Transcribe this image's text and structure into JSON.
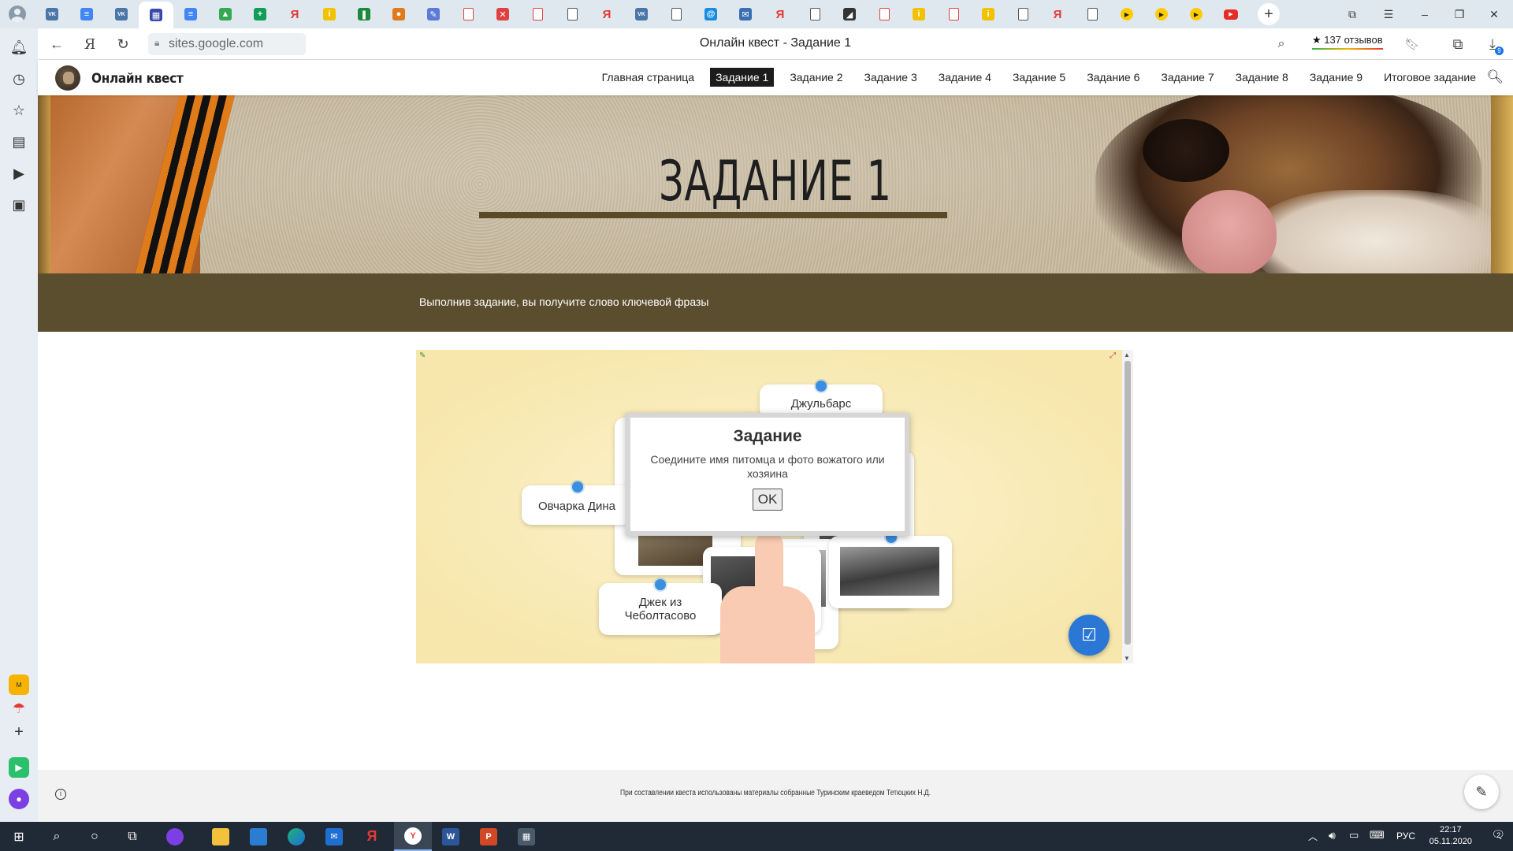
{
  "browser": {
    "tabs": [
      {
        "icon": "vk-icon",
        "glyph": "VK",
        "color": "#4a76a8",
        "kind": "box"
      },
      {
        "icon": "docs-icon",
        "glyph": "≡",
        "color": "#4285f4",
        "kind": "box"
      },
      {
        "icon": "vk-icon",
        "glyph": "VK",
        "color": "#4a76a8",
        "kind": "box"
      },
      {
        "icon": "google-sites-icon",
        "glyph": "▦",
        "color": "#3949ab",
        "kind": "box",
        "active": true
      },
      {
        "icon": "docs-icon",
        "glyph": "≡",
        "color": "#4285f4",
        "kind": "box"
      },
      {
        "icon": "drive-icon",
        "glyph": "▲",
        "color": "#34a853",
        "kind": "box"
      },
      {
        "icon": "sheets-icon",
        "glyph": "+",
        "color": "#0f9d58",
        "kind": "box"
      },
      {
        "icon": "yandex-icon",
        "glyph": "Я",
        "color": "#e53935",
        "kind": "ya"
      },
      {
        "icon": "yellow-tab-icon",
        "glyph": "i",
        "color": "#f2c200",
        "kind": "box"
      },
      {
        "icon": "green-tab-icon",
        "glyph": "❚",
        "color": "#1b8a3a",
        "kind": "box"
      },
      {
        "icon": "colorful-tab-icon",
        "glyph": "●",
        "color": "#e07a1a",
        "kind": "box"
      },
      {
        "icon": "edit-tab-icon",
        "glyph": "✎",
        "color": "#5b7bd6",
        "kind": "box"
      },
      {
        "icon": "pdf-icon",
        "glyph": "",
        "color": "#e04040",
        "kind": "pdf"
      },
      {
        "icon": "red-circle-icon",
        "glyph": "✕",
        "color": "#e04040",
        "kind": "box"
      },
      {
        "icon": "pdf-icon",
        "glyph": "",
        "color": "#e04040",
        "kind": "pdf"
      },
      {
        "icon": "document-icon",
        "glyph": "",
        "color": "#555",
        "kind": "doc"
      },
      {
        "icon": "yandex-icon",
        "glyph": "Я",
        "color": "#e53935",
        "kind": "ya"
      },
      {
        "icon": "vk-icon",
        "glyph": "VK",
        "color": "#4a76a8",
        "kind": "box"
      },
      {
        "icon": "document-icon",
        "glyph": "",
        "color": "#555",
        "kind": "doc"
      },
      {
        "icon": "mail-ru-icon",
        "glyph": "@",
        "color": "#168de2",
        "kind": "box"
      },
      {
        "icon": "mail-icon",
        "glyph": "✉",
        "color": "#3a6fb0",
        "kind": "box"
      },
      {
        "icon": "yandex-icon",
        "glyph": "Я",
        "color": "#e53935",
        "kind": "ya"
      },
      {
        "icon": "document-icon",
        "glyph": "",
        "color": "#555",
        "kind": "doc"
      },
      {
        "icon": "dark-tab-icon",
        "glyph": "◢",
        "color": "#333",
        "kind": "box"
      },
      {
        "icon": "pdf-icon",
        "glyph": "",
        "color": "#e04040",
        "kind": "pdf"
      },
      {
        "icon": "yellow-tab-icon",
        "glyph": "i",
        "color": "#f2c200",
        "kind": "box"
      },
      {
        "icon": "pdf-icon",
        "glyph": "",
        "color": "#e04040",
        "kind": "pdf"
      },
      {
        "icon": "yellow-tab-icon",
        "glyph": "i",
        "color": "#f2c200",
        "kind": "box"
      },
      {
        "icon": "document-icon",
        "glyph": "",
        "color": "#555",
        "kind": "doc"
      },
      {
        "icon": "yandex-icon",
        "glyph": "Я",
        "color": "#e53935",
        "kind": "ya"
      },
      {
        "icon": "document-icon",
        "glyph": "",
        "color": "#555",
        "kind": "doc"
      },
      {
        "icon": "video-play-icon",
        "glyph": "▶",
        "color": "#ffcc00",
        "kind": "play"
      },
      {
        "icon": "video-play-icon",
        "glyph": "▶",
        "color": "#ffcc00",
        "kind": "play"
      },
      {
        "icon": "video-play-icon",
        "glyph": "▶",
        "color": "#ffcc00",
        "kind": "play"
      },
      {
        "icon": "youtube-icon",
        "glyph": "▶",
        "color": "#e52d27",
        "kind": "yt"
      }
    ],
    "address": {
      "host": "sites.google.com",
      "page_title": "Онлайн квест - Задание 1",
      "reviews": "137 отзывов",
      "reviews_star": "★",
      "download_badge": "9"
    }
  },
  "site": {
    "name": "Онлайн квест",
    "nav": [
      {
        "label": "Главная страница",
        "active": false
      },
      {
        "label": "Задание 1",
        "active": true
      },
      {
        "label": "Задание 2",
        "active": false
      },
      {
        "label": "Задание 3",
        "active": false
      },
      {
        "label": "Задание 4",
        "active": false
      },
      {
        "label": "Задание 5",
        "active": false
      },
      {
        "label": "Задание 6",
        "active": false
      },
      {
        "label": "Задание 7",
        "active": false
      },
      {
        "label": "Задание 8",
        "active": false
      },
      {
        "label": "Задание 9",
        "active": false
      },
      {
        "label": "Итоговое задание",
        "active": false
      }
    ],
    "hero_title": "ЗАДАНИЕ 1",
    "info_text": "Выполнив задание, вы получите слово ключевой фразы",
    "footer_text": "При составлении квеста использованы материалы собранные Туринским краеведом Тетюцких Н.Д."
  },
  "task": {
    "cards": {
      "dzhulbars": "Джульбарс",
      "ovcharka": "Овчарка Дина",
      "dzhek": "Джек из Чеболтасово"
    },
    "modal": {
      "title": "Задание",
      "text": "Соедините имя питомца и фото вожатого или хозяина",
      "ok": "OK"
    }
  },
  "taskbar": {
    "lang": "РУС",
    "time": "22:17",
    "date": "05.11.2020",
    "notifications": "2"
  },
  "colors": {
    "accent": "#2a77d6",
    "olive": "#5b4e2e",
    "nav_active": "#1c1c1c",
    "card_dot": "#3b8ee0"
  }
}
